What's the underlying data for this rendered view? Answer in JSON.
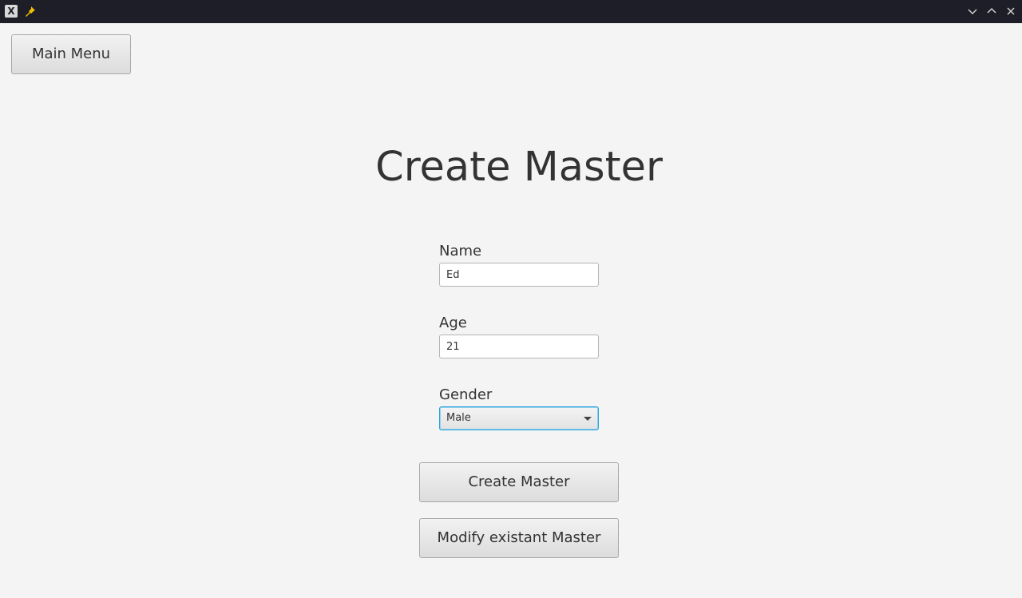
{
  "window": {
    "app_icon_glyph": "X",
    "icons": {
      "pin": "pin-icon",
      "minimize": "chevron-down-icon",
      "maximize": "chevron-up-icon",
      "close": "close-icon"
    }
  },
  "toolbar": {
    "main_menu_label": "Main Menu"
  },
  "page": {
    "title": "Create Master"
  },
  "form": {
    "name_label": "Name",
    "name_value": "Ed",
    "age_label": "Age",
    "age_value": "21",
    "gender_label": "Gender",
    "gender_value": "Male"
  },
  "actions": {
    "create_label": "Create Master",
    "modify_label": "Modify existant Master"
  },
  "colors": {
    "titlebar": "#1e1e28",
    "background": "#f4f4f4",
    "focus_accent": "#2a9fd6",
    "pin_accent": "#f0c000"
  }
}
